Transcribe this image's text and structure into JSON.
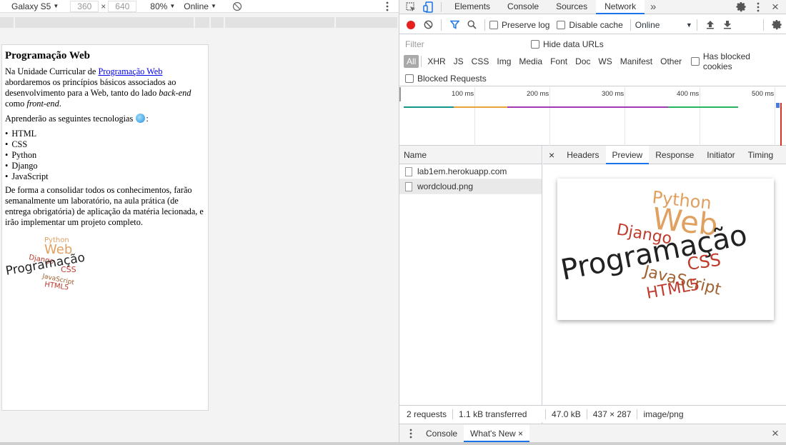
{
  "device_toolbar": {
    "device": "Galaxy S5",
    "width": "360",
    "times": "×",
    "height": "640",
    "zoom": "80%",
    "throttle": "Online"
  },
  "page": {
    "heading": "Programação Web",
    "p1_pre": "Na Unidade Curricular de ",
    "p1_link": "Programação Web",
    "p1_mid": " abordaremos os princípios básicos associados ao desenvolvimento para a Web, tanto do lado ",
    "p1_em1": "back-end",
    "p1_and": " como ",
    "p1_em2": "front-end",
    "p1_end": ".",
    "p2": "Aprenderão as seguintes tecnologias ",
    "p2_end": ":",
    "techs": [
      "HTML",
      "CSS",
      "Python",
      "Django",
      "JavaScript"
    ],
    "p3": "De forma a consolidar todos os conhecimentos, farão semanalmente um laboratório, na aula prática (de entrega obrigatória) de aplicação da matéria lecionada, e irão implementar um projeto completo."
  },
  "wordcloud": {
    "python": "Python",
    "web": "Web",
    "django": "Django",
    "programacao": "Programação",
    "css": "CSS",
    "javascript": "JavaScript",
    "html5": "HTML5"
  },
  "devtools": {
    "tabs": [
      "Elements",
      "Console",
      "Sources",
      "Network"
    ],
    "active_tab": "Network",
    "more": "»"
  },
  "network_toolbar": {
    "preserve_log": "Preserve log",
    "disable_cache": "Disable cache",
    "throttle": "Online",
    "throttle_arrow": "▼"
  },
  "filter": {
    "placeholder": "Filter",
    "hide_data_urls": "Hide data URLs",
    "types": [
      "All",
      "XHR",
      "JS",
      "CSS",
      "Img",
      "Media",
      "Font",
      "Doc",
      "WS",
      "Manifest",
      "Other"
    ],
    "has_blocked_cookies": "Has blocked cookies",
    "blocked_requests": "Blocked Requests"
  },
  "timeline": {
    "ticks": [
      "100 ms",
      "200 ms",
      "300 ms",
      "400 ms",
      "500 ms"
    ]
  },
  "requests": {
    "header": "Name",
    "items": [
      "lab1em.herokuapp.com",
      "wordcloud.png"
    ]
  },
  "detail": {
    "close": "×",
    "tabs": [
      "Headers",
      "Preview",
      "Response",
      "Initiator",
      "Timing"
    ],
    "active": "Preview"
  },
  "status": {
    "requests": "2 requests",
    "transferred": "1.1 kB transferred",
    "size": "47.0 kB",
    "dimensions": "437 × 287",
    "mime": "image/png"
  },
  "drawer": {
    "console": "Console",
    "whats_new": "What's New",
    "close": "×"
  },
  "icons": {
    "close": "×",
    "arrow": "▼"
  },
  "colors": {
    "accent": "#1a73e8",
    "record": "#e61f1f",
    "wordcloud_orange": "#e0a060",
    "wordcloud_red": "#c0392b",
    "wordcloud_dark": "#222222"
  }
}
